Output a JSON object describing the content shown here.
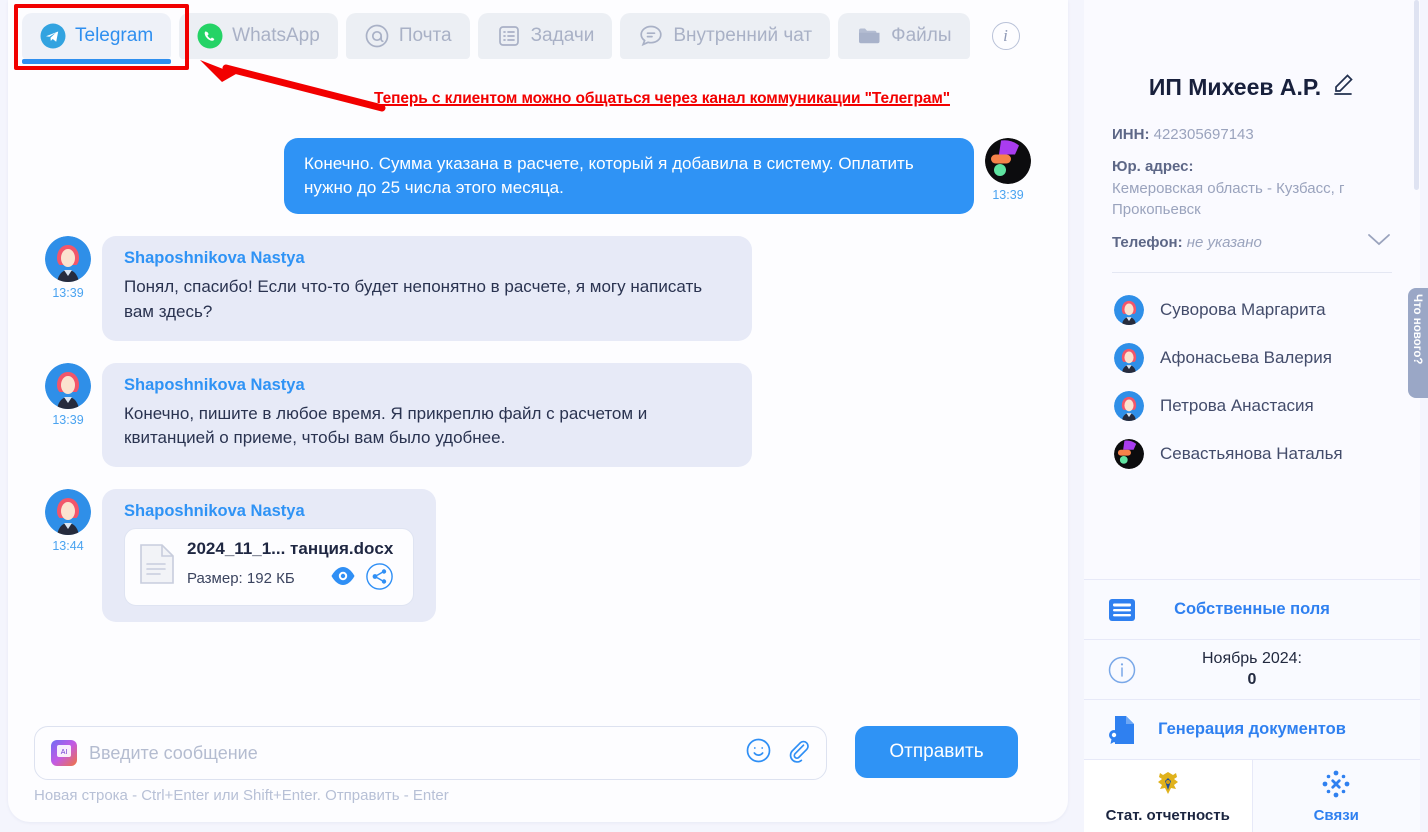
{
  "tabs": [
    {
      "label": "Telegram",
      "icon": "telegram-icon",
      "active": true
    },
    {
      "label": "WhatsApp",
      "icon": "whatsapp-icon",
      "active": false
    },
    {
      "label": "Почта",
      "icon": "mail-at-icon",
      "active": false
    },
    {
      "label": "Задачи",
      "icon": "tasks-list-icon",
      "active": false
    },
    {
      "label": "Внутренний чат",
      "icon": "internal-chat-icon",
      "active": false
    },
    {
      "label": "Файлы",
      "icon": "folder-icon",
      "active": false
    }
  ],
  "info_button": "i",
  "annotation": {
    "text": "Теперь с клиентом можно общаться через канал коммуникации \"Телеграм\"",
    "color": "#f20000"
  },
  "messages": [
    {
      "direction": "out",
      "text": "Конечно. Сумма указана в расчете, который я добавила в систему. Оплатить нужно до 25 числа этого месяца.",
      "time": "13:39",
      "avatar": "abstract-dark-avatar"
    },
    {
      "direction": "in",
      "sender": "Shaposhnikova Nastya",
      "text": "Понял, спасибо! Если что-то будет непонятно в расчете, я могу написать вам здесь?",
      "time": "13:39",
      "avatar": "woman-avatar"
    },
    {
      "direction": "in",
      "sender": "Shaposhnikova Nastya",
      "text": "Конечно, пишите в любое время. Я прикреплю файл с расчетом и квитанцией о приеме, чтобы вам было удобнее.",
      "time": "13:39",
      "avatar": "woman-avatar"
    },
    {
      "direction": "in",
      "sender": "Shaposhnikova Nastya",
      "time": "13:44",
      "avatar": "woman-avatar",
      "attachment": {
        "name": "2024_11_1...  танция.docx",
        "size_label": "Размер: 192 КБ",
        "actions": [
          "eye-preview-icon",
          "share-icon"
        ]
      }
    }
  ],
  "composer": {
    "placeholder": "Введите сообщение",
    "send_label": "Отправить",
    "hint": "Новая строка - Ctrl+Enter или Shift+Enter. Отправить - Enter",
    "icons": [
      "ai-assistant-icon",
      "emoji-icon",
      "attach-clip-icon"
    ]
  },
  "sidebar": {
    "client_name": "ИП Михеев А.Р.",
    "edit_icon": "pencil-edit-icon",
    "fields": [
      {
        "key": "ИНН:",
        "value": "422305697143",
        "italic": false
      },
      {
        "key": "Юр. адрес:",
        "value": "Кемеровская область - Кузбасс, г Прокопьевск",
        "italic": false
      },
      {
        "key": "Телефон:",
        "value": "не указано",
        "italic": true
      }
    ],
    "contacts": [
      {
        "name": "Суворова Маргарита",
        "avatar": "woman-avatar"
      },
      {
        "name": "Афонасьева Валерия",
        "avatar": "woman-avatar"
      },
      {
        "name": "Петрова Анастасия",
        "avatar": "woman-avatar"
      },
      {
        "name": "Севастьянова Наталья",
        "avatar": "abstract-dark-avatar"
      }
    ],
    "cards": [
      {
        "label": "Собственные поля",
        "icon": "fields-list-icon"
      },
      {
        "label": "Ноябрь 2024:",
        "value": "0",
        "icon": "info-circle-icon"
      },
      {
        "label": "Генерация документов",
        "icon": "document-generate-icon"
      }
    ],
    "duo_cards": [
      {
        "label": "Стат. отчетность",
        "icon": "russian-coat-of-arms-icon"
      },
      {
        "label": "Связи",
        "icon": "connections-network-icon"
      }
    ]
  },
  "edge_widget": {
    "label": "Что нового?"
  },
  "colors": {
    "accent": "#2f93f5",
    "bubble_in": "#e7eaf7",
    "annotation_red": "#f20000",
    "page_bg": "#f4f5fd"
  }
}
